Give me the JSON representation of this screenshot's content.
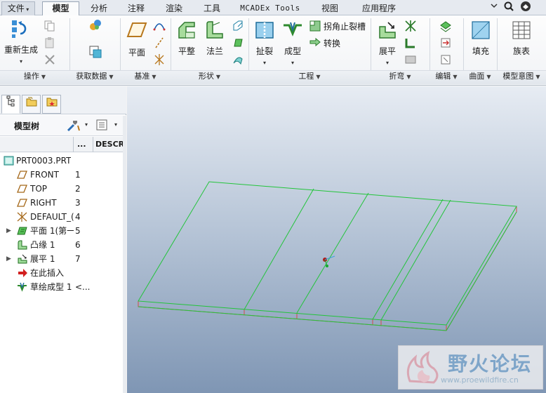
{
  "menubar": {
    "tabs": [
      {
        "label": "文件",
        "dropdown": true
      },
      {
        "label": "模型",
        "active": true
      },
      {
        "label": "分析"
      },
      {
        "label": "注释"
      },
      {
        "label": "渲染"
      },
      {
        "label": "工具"
      },
      {
        "label": "MCADEx Tools"
      },
      {
        "label": "视图"
      },
      {
        "label": "应用程序"
      }
    ],
    "right_icons": [
      "minimize-icon",
      "search-icon",
      "user-icon"
    ]
  },
  "ribbon": {
    "groups": [
      {
        "label": "操作"
      },
      {
        "label": "获取数据"
      },
      {
        "label": "基准"
      },
      {
        "label": "形状"
      },
      {
        "label": "工程"
      },
      {
        "label": "折弯"
      },
      {
        "label": "编辑"
      },
      {
        "label": "曲面"
      },
      {
        "label": "模型意图"
      }
    ],
    "buttons": {
      "regenerate": "重新生成",
      "plane": "平面",
      "flat": "平整",
      "flange": "法兰",
      "rip": "扯裂",
      "form": "成型",
      "corner_relief": "拐角止裂槽",
      "convert": "转换",
      "unbend": "展平",
      "fill": "填充",
      "family_table": "族表"
    }
  },
  "model_tree": {
    "title": "模型树",
    "columns": [
      "...",
      "DESCR"
    ],
    "items": [
      {
        "name": "PRT0003.PRT",
        "num": "",
        "icon": "part-icon",
        "expandable": false
      },
      {
        "name": "FRONT",
        "num": "1",
        "icon": "datum-plane-icon",
        "expandable": false
      },
      {
        "name": "TOP",
        "num": "2",
        "icon": "datum-plane-icon",
        "expandable": false
      },
      {
        "name": "RIGHT",
        "num": "3",
        "icon": "datum-plane-icon",
        "expandable": false
      },
      {
        "name": "DEFAULT_(",
        "num": "4",
        "icon": "coordinate-system-icon",
        "expandable": false
      },
      {
        "name": "平面 1(第一",
        "num": "5",
        "icon": "planar-wall-icon",
        "expandable": true
      },
      {
        "name": "凸缘 1",
        "num": "6",
        "icon": "flange-icon",
        "expandable": false
      },
      {
        "name": "展平 1",
        "num": "7",
        "icon": "unbend-icon",
        "expandable": true
      },
      {
        "name": "在此插入",
        "num": "",
        "icon": "insert-here-icon",
        "expandable": false
      },
      {
        "name": "草绘成型 1",
        "num": "<...",
        "icon": "sketched-form-icon",
        "expandable": false
      }
    ]
  },
  "watermark": {
    "title": "野火论坛",
    "url": "www.proewildfire.cn"
  },
  "colors": {
    "model_edges": "#22c43a",
    "model_thickness": "#d24a4a",
    "viewport_top": "#e7ecf3",
    "viewport_bottom": "#7f96b4"
  }
}
